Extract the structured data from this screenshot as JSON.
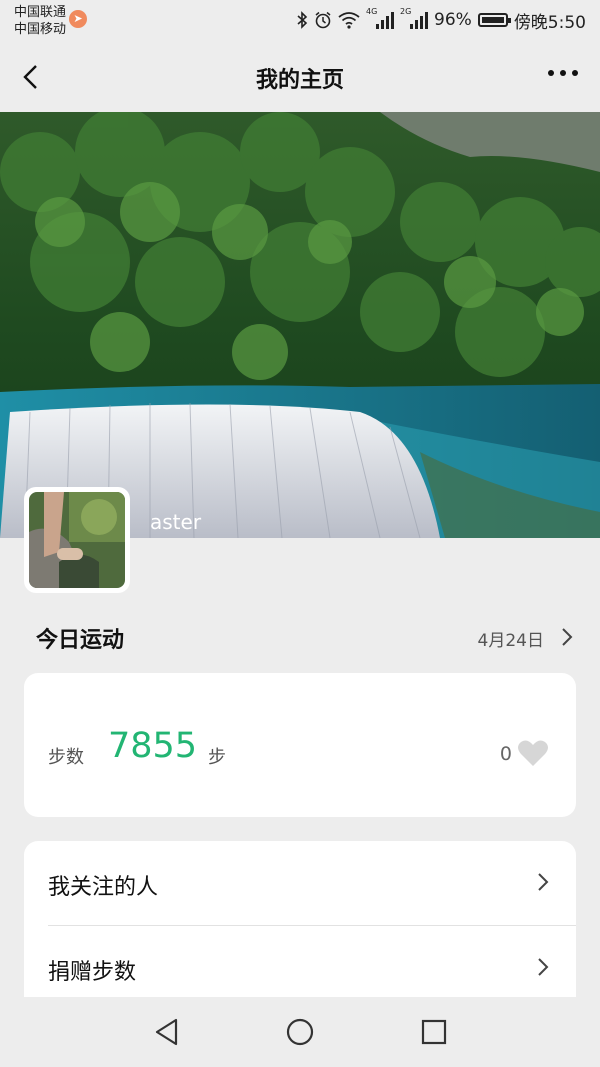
{
  "status_bar": {
    "carrier_1": "中国联通",
    "carrier_2": "中国移动",
    "net_4g": "4G",
    "net_2g": "2G",
    "battery": "96%",
    "time": "傍晚5:50"
  },
  "nav": {
    "title": "我的主页"
  },
  "profile": {
    "username": "aster"
  },
  "today": {
    "title": "今日运动",
    "date": "4月24日",
    "steps_label": "步数",
    "steps_value": "7855",
    "steps_unit": "步",
    "likes": "0"
  },
  "menu": {
    "items": [
      {
        "label": "我关注的人"
      },
      {
        "label": "捐赠步数"
      }
    ]
  },
  "colors": {
    "accent": "#22b573",
    "background": "#ededed",
    "card": "#ffffff"
  }
}
